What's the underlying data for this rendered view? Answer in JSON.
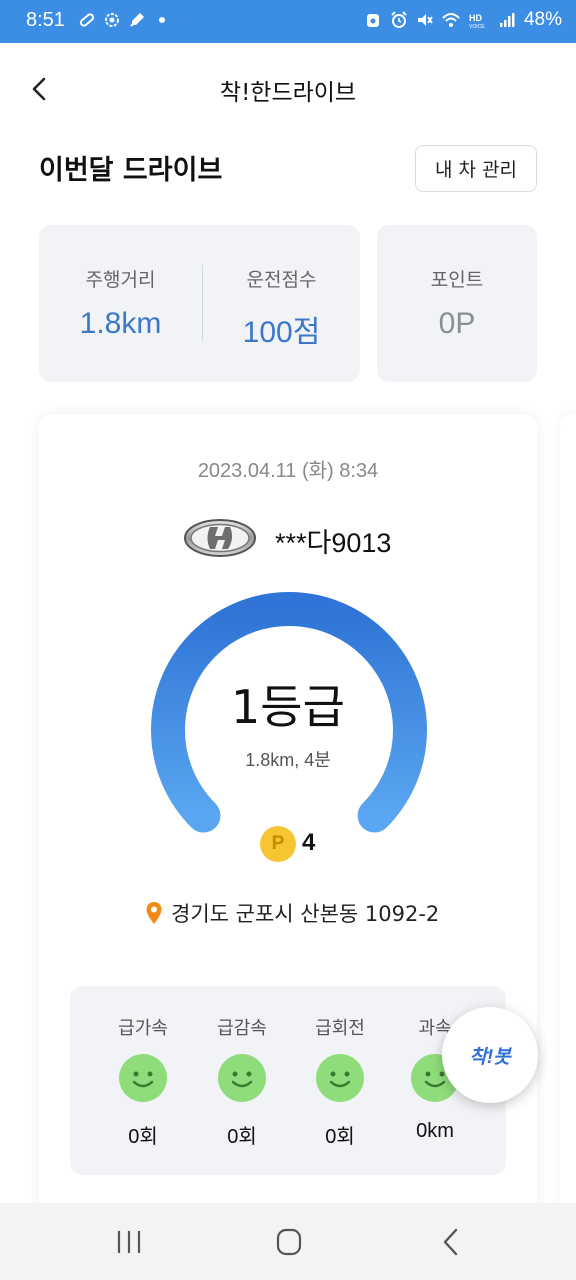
{
  "status_bar": {
    "time": "8:51",
    "battery": "48%",
    "left_icons": [
      "pill-icon",
      "settings-ring-icon",
      "rocket-icon",
      "dot-icon"
    ],
    "right_icons": [
      "home-lock-icon",
      "alarm-icon",
      "mute-icon",
      "wifi-icon",
      "hd-voice-icon",
      "signal-icon"
    ]
  },
  "header": {
    "title": "착!한드라이브",
    "back_icon": "chevron-left-icon"
  },
  "section": {
    "title": "이번달 드라이브",
    "my_car_button": "내 차 관리"
  },
  "stats": {
    "distance_label": "주행거리",
    "distance_value": "1.8km",
    "score_label": "운전점수",
    "score_value": "100점",
    "point_label": "포인트",
    "point_value": "0P"
  },
  "drive": {
    "date": "2023.04.11 (화) 8:34",
    "plate": "***다9013",
    "gauge_fraction": 1.0,
    "grade": "1등급",
    "summary": "1.8km, 4분",
    "point_badge": "P",
    "points_earned": "4",
    "location": "경기도 군포시 산본동 1092-2",
    "events": [
      {
        "label": "급가속",
        "value": "0회"
      },
      {
        "label": "급감속",
        "value": "0회"
      },
      {
        "label": "급회전",
        "value": "0회"
      },
      {
        "label": "과속",
        "value": "0km"
      }
    ]
  },
  "bot_button": {
    "label": "착!봇"
  },
  "nav": {
    "recent": "recents-icon",
    "home": "home-icon",
    "back": "back-icon"
  },
  "colors": {
    "status_bar": "#3b8ee3",
    "accent_blue": "#3a78c8",
    "gauge_start": "#5aa6f0",
    "gauge_end": "#2f74d6",
    "face_green": "#8fdc7a",
    "point_yellow": "#f6c531",
    "pin_orange": "#f28a16"
  }
}
